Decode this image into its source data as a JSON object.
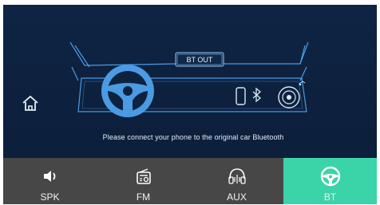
{
  "main": {
    "bt_out_label": "BT OUT",
    "message": "Please connect your phone to the original car Bluetooth"
  },
  "icons": {
    "home": "home-icon",
    "steering": "steering-wheel-icon",
    "phone": "phone-icon",
    "bluetooth": "bluetooth-icon",
    "speaker": "car-speaker-icon"
  },
  "tabs": [
    {
      "label": "SPK",
      "icon": "speaker-icon",
      "active": false
    },
    {
      "label": "FM",
      "icon": "radio-icon",
      "active": false
    },
    {
      "label": "AUX",
      "icon": "headphones-icon",
      "active": false
    },
    {
      "label": "BT",
      "icon": "steering-wheel-icon",
      "active": true
    }
  ],
  "colors": {
    "background": "#0e2240",
    "line": "#4a9be3",
    "tabbar": "#474747",
    "active_tab": "#3bd3a8"
  }
}
